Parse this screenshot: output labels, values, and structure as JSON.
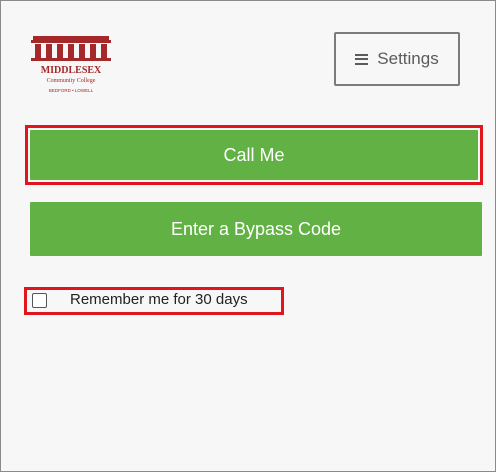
{
  "logo": {
    "name": "MIDDLESEX",
    "subtitle": "Community College",
    "campuses": "BEDFORD • LOWELL",
    "color": "#a5282a"
  },
  "settings": {
    "label": "Settings",
    "icon": "hamburger-menu-icon"
  },
  "actions": {
    "call_label": "Call Me",
    "bypass_label": "Enter a Bypass Code"
  },
  "remember": {
    "label": "Remember me for 30 days",
    "checked": false
  },
  "colors": {
    "primary_button": "#62b144",
    "highlight": "#e1161c",
    "background": "#f7f7f7"
  }
}
